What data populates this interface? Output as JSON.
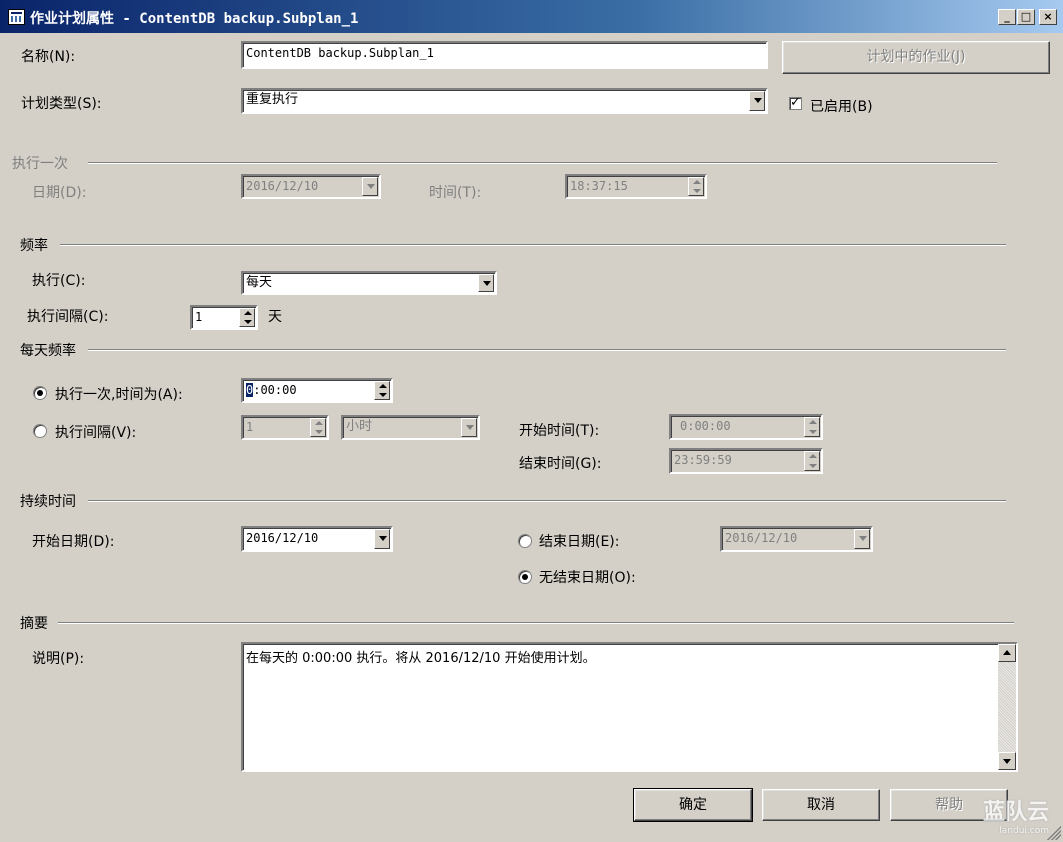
{
  "window": {
    "title": "作业计划属性 - ContentDB backup.Subplan_1",
    "controls": {
      "minimize": "_",
      "maximize": "□",
      "close": "×"
    }
  },
  "name": {
    "label": "名称(N):",
    "value": "ContentDB backup.Subplan_1"
  },
  "jobs_in_schedule_button": "计划中的作业(J)",
  "schedule_type": {
    "label": "计划类型(S):",
    "value": "重复执行"
  },
  "enabled": {
    "label": "已启用(B)",
    "checked": true
  },
  "one_time": {
    "group": "执行一次",
    "date_label": "日期(D):",
    "date_value": "2016/12/10",
    "time_label": "时间(T):",
    "time_value": "18:37:15"
  },
  "frequency": {
    "group": "频率",
    "occurs_label": "执行(C):",
    "occurs_value": "每天",
    "recurs_label": "执行间隔(C):",
    "recurs_value": "1",
    "recurs_unit": "天"
  },
  "daily_frequency": {
    "group": "每天频率",
    "once_label": "执行一次,时间为(A):",
    "once_time_caret": "0",
    "once_time_rest": ":00:00",
    "every_label": "执行间隔(V):",
    "every_value": "1",
    "every_unit": "小时",
    "start_label": "开始时间(T):",
    "start_value": "0:00:00",
    "end_label": "结束时间(G):",
    "end_value": "23:59:59",
    "selected": "once"
  },
  "duration": {
    "group": "持续时间",
    "start_label": "开始日期(D):",
    "start_value": "2016/12/10",
    "end_label": "结束日期(E):",
    "end_value": "2016/12/10",
    "no_end_label": "无结束日期(O):",
    "selected": "no_end"
  },
  "summary": {
    "group": "摘要",
    "desc_label": "说明(P):",
    "desc_text": "在每天的 0:00:00 执行。将从 2016/12/10 开始使用计划。"
  },
  "buttons": {
    "ok": "确定",
    "cancel": "取消",
    "help": "帮助"
  },
  "watermark": {
    "brand": "蓝队云",
    "domain": "landui.com"
  },
  "colors": {
    "face": "#d4d0c8",
    "title_start": "#0a246a",
    "title_end": "#a6caf0",
    "disabled_text": "#808080"
  }
}
